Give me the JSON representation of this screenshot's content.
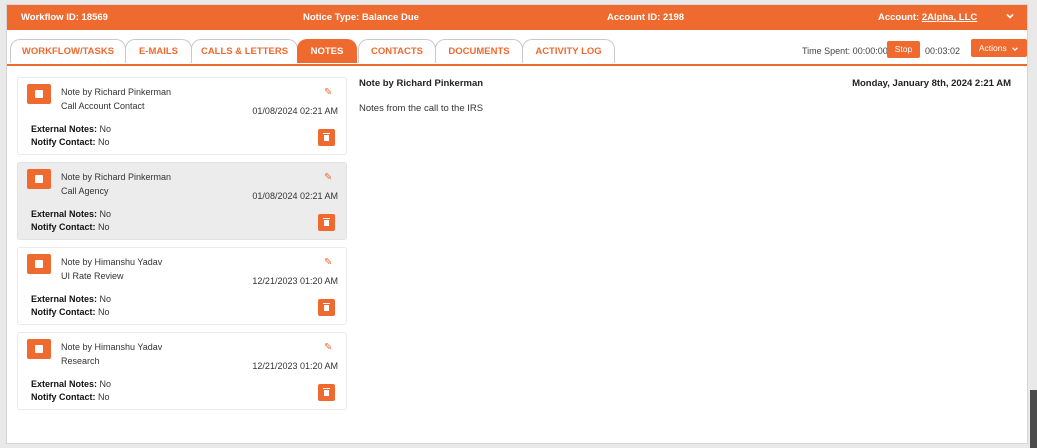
{
  "header": {
    "workflow_id": "Workflow ID: 18569",
    "notice_type": "Notice Type: Balance Due",
    "account_id": "Account ID: 2198",
    "account_label": "Account:",
    "account_name": "2Alpha, LLC",
    "expand_icon": "chevron-down-icon",
    "bar_color": "#ee6a2f"
  },
  "tabs": [
    {
      "label": "WORKFLOW/TASKS",
      "active": false
    },
    {
      "label": "E-MAILS",
      "active": false
    },
    {
      "label": "CALLS & LETTERS",
      "active": false
    },
    {
      "label": "NOTES",
      "active": true
    },
    {
      "label": "CONTACTS",
      "active": false
    },
    {
      "label": "DOCUMENTS",
      "active": false
    },
    {
      "label": "ACTIVITY LOG",
      "active": false
    }
  ],
  "timer": {
    "time_spent": "Time Spent: 00:00:00",
    "stop_label": "Stop",
    "elapsed": "00:03:02",
    "actions_label": "Actions"
  },
  "notes": [
    {
      "author": "Note by Richard Pinkerman",
      "subject": "Call Account Contact",
      "date": "01/08/2024 02:21 AM",
      "external_label": "External Notes:",
      "external_value": "No",
      "notify_label": "Notify Contact:",
      "notify_value": "No",
      "selected": false
    },
    {
      "author": "Note by Richard Pinkerman",
      "subject": "Call Agency",
      "date": "01/08/2024 02:21 AM",
      "external_label": "External Notes:",
      "external_value": "No",
      "notify_label": "Notify Contact:",
      "notify_value": "No",
      "selected": true
    },
    {
      "author": "Note by Himanshu Yadav",
      "subject": "UI Rate Review",
      "date": "12/21/2023 01:20 AM",
      "external_label": "External Notes:",
      "external_value": "No",
      "notify_label": "Notify Contact:",
      "notify_value": "No",
      "selected": false
    },
    {
      "author": "Note by Himanshu Yadav",
      "subject": "Research",
      "date": "12/21/2023 01:20 AM",
      "external_label": "External Notes:",
      "external_value": "No",
      "notify_label": "Notify Contact:",
      "notify_value": "No",
      "selected": false
    }
  ],
  "detail": {
    "author": "Note by Richard Pinkerman",
    "date": "Monday, January 8th, 2024 2:21 AM",
    "body": "Notes from the call to the IRS"
  }
}
